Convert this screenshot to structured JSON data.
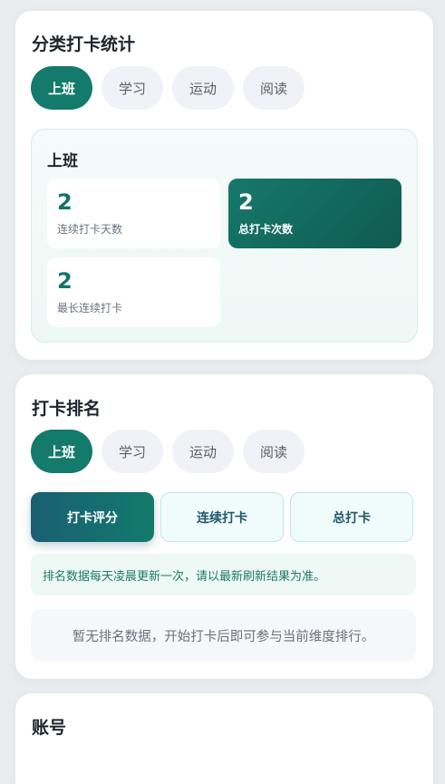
{
  "category_stats": {
    "title": "分类打卡统计",
    "chips": [
      "上班",
      "学习",
      "运动",
      "阅读"
    ],
    "selected_label": "上班",
    "stats": [
      {
        "value": "2",
        "label": "连续打卡天数"
      },
      {
        "value": "2",
        "label": "总打卡次数"
      },
      {
        "value": "2",
        "label": "最长连续打卡"
      }
    ]
  },
  "ranking": {
    "title": "打卡排名",
    "chips": [
      "上班",
      "学习",
      "运动",
      "阅读"
    ],
    "tabs": [
      "打卡评分",
      "连续打卡",
      "总打卡"
    ],
    "notice": "排名数据每天凌晨更新一次，请以最新刷新结果为准。",
    "empty_text": "暂无排名数据，开始打卡后即可参与当前维度排行。"
  },
  "account": {
    "title": "账号"
  },
  "colors": {
    "accent": "#137a6c",
    "accent_dark": "#0f5a50",
    "background": "#e9edf0"
  }
}
